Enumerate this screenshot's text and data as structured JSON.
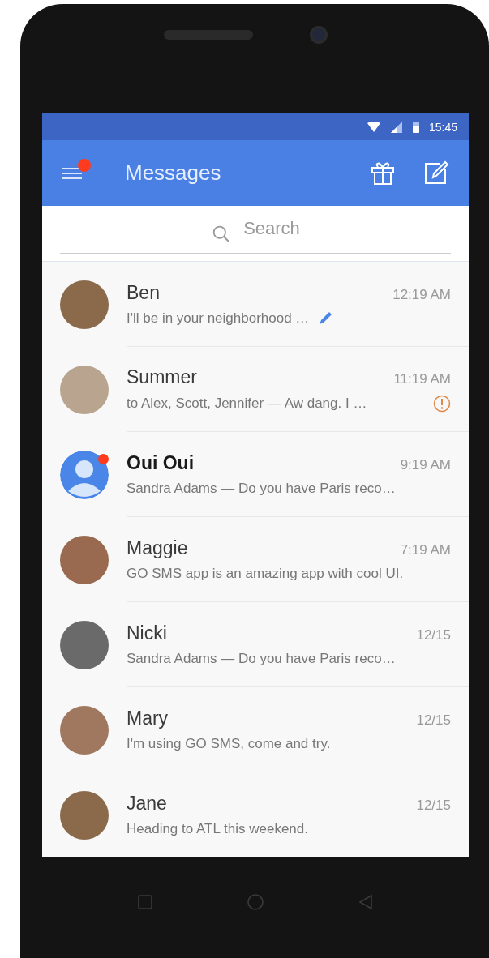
{
  "status_bar": {
    "time": "15:45"
  },
  "app_bar": {
    "title": "Messages",
    "menu_badge": true
  },
  "search": {
    "placeholder": "Search"
  },
  "conversations": [
    {
      "name": "Ben",
      "preview": "I'll be in your neighborhood …",
      "time": "12:19 AM",
      "kind": "photo",
      "unread": false,
      "draft": true,
      "failed": false
    },
    {
      "name": "Summer",
      "preview": "to Alex, Scott, Jennifer — Aw dang. I …",
      "time": "11:19 AM",
      "kind": "photo",
      "unread": false,
      "draft": false,
      "failed": true
    },
    {
      "name": "Oui Oui",
      "preview": "Sandra Adams — Do you have Paris reco…",
      "time": "9:19 AM",
      "kind": "default",
      "unread": true,
      "draft": false,
      "failed": false
    },
    {
      "name": "Maggie",
      "preview": "GO SMS app is an amazing app with cool UI.",
      "time": "7:19 AM",
      "kind": "photo",
      "unread": false,
      "draft": false,
      "failed": false
    },
    {
      "name": "Nicki",
      "preview": "Sandra Adams — Do you have Paris reco…",
      "time": "12/15",
      "kind": "photo",
      "unread": false,
      "draft": false,
      "failed": false
    },
    {
      "name": "Mary",
      "preview": "I'm using GO SMS, come and try.",
      "time": "12/15",
      "kind": "photo",
      "unread": false,
      "draft": false,
      "failed": false
    },
    {
      "name": "Jane",
      "preview": "Heading to ATL this weekend.",
      "time": "12/15",
      "kind": "photo",
      "unread": false,
      "draft": false,
      "failed": false
    }
  ]
}
